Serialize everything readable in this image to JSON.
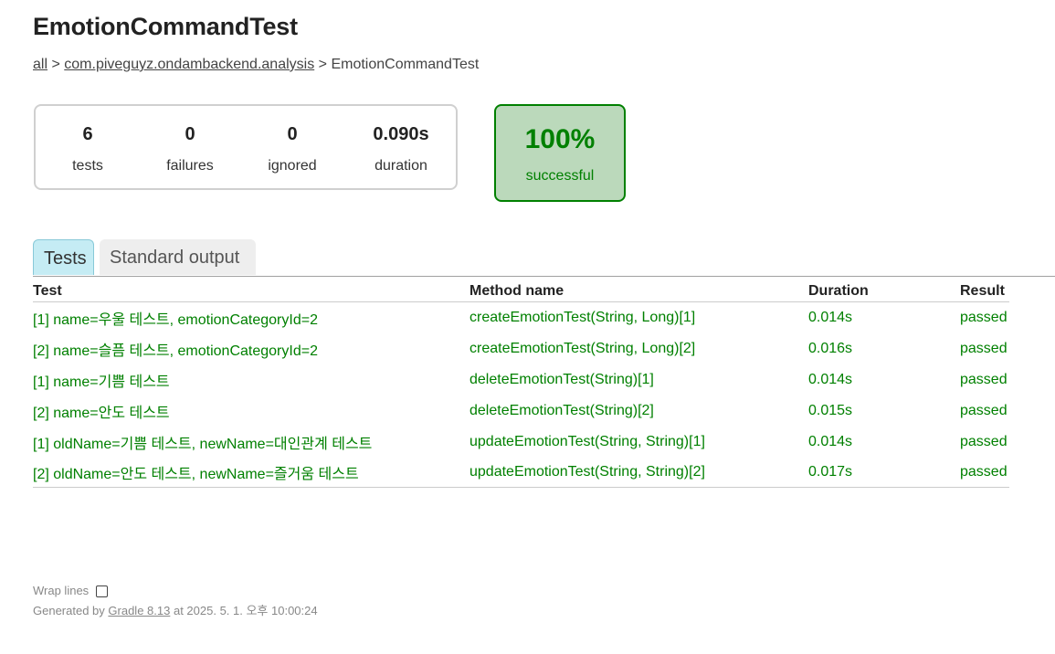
{
  "page_title": "EmotionCommandTest",
  "breadcrumb": {
    "all_link": "all",
    "separator1": ">",
    "package_link": "com.piveguyz.ondambackend.analysis",
    "separator2": ">",
    "current": "EmotionCommandTest"
  },
  "summary": {
    "tests": {
      "value": "6",
      "label": "tests"
    },
    "failures": {
      "value": "0",
      "label": "failures"
    },
    "ignored": {
      "value": "0",
      "label": "ignored"
    },
    "duration": {
      "value": "0.090s",
      "label": "duration"
    }
  },
  "success_rate": {
    "value": "100%",
    "label": "successful",
    "color": "#008000",
    "background": "#bbd9bb"
  },
  "tabs": [
    {
      "label": "Tests",
      "selected": true
    },
    {
      "label": "Standard output",
      "selected": false
    }
  ],
  "table": {
    "headers": [
      "Test",
      "Method name",
      "Duration",
      "Result"
    ],
    "rows": [
      {
        "test": "[1] name=우울 테스트, emotionCategoryId=2",
        "method": "createEmotionTest(String, Long)[1]",
        "duration": "0.014s",
        "result": "passed"
      },
      {
        "test": "[2] name=슬픔 테스트, emotionCategoryId=2",
        "method": "createEmotionTest(String, Long)[2]",
        "duration": "0.016s",
        "result": "passed"
      },
      {
        "test": "[1] name=기쁨 테스트",
        "method": "deleteEmotionTest(String)[1]",
        "duration": "0.014s",
        "result": "passed"
      },
      {
        "test": "[2] name=안도 테스트",
        "method": "deleteEmotionTest(String)[2]",
        "duration": "0.015s",
        "result": "passed"
      },
      {
        "test": "[1] oldName=기쁨 테스트, newName=대인관계 테스트",
        "method": "updateEmotionTest(String, String)[1]",
        "duration": "0.014s",
        "result": "passed"
      },
      {
        "test": "[2] oldName=안도 테스트, newName=즐거움 테스트",
        "method": "updateEmotionTest(String, String)[2]",
        "duration": "0.017s",
        "result": "passed"
      }
    ]
  },
  "footer": {
    "wrap_lines_label": "Wrap lines",
    "wrap_lines_checked": false,
    "generated_prefix": "Generated by",
    "gradle_link": "Gradle 8.13",
    "generated_suffix": "at 2025. 5. 1. 오후 10:00:24"
  }
}
